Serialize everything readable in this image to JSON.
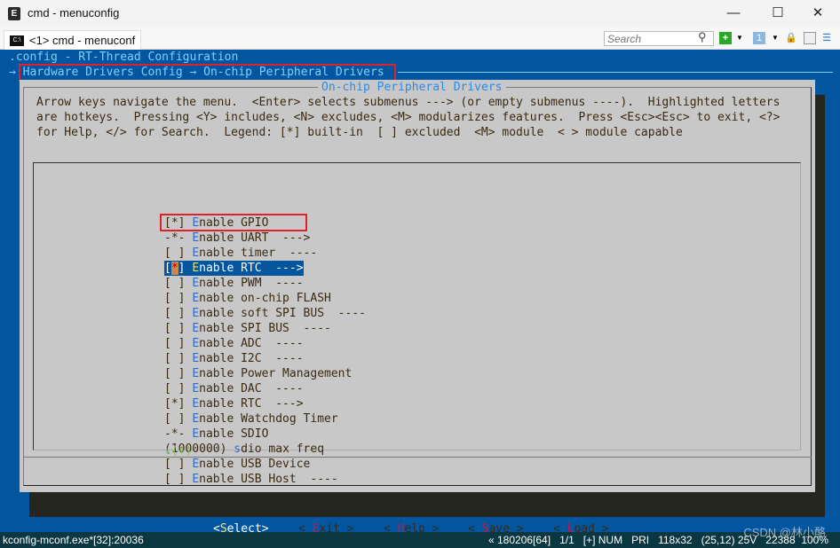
{
  "window": {
    "title": "cmd - menuconfig",
    "app_icon": "conemu-icon",
    "controls": [
      "minimize",
      "maximize",
      "close"
    ]
  },
  "tabbar": {
    "tab_label": "<1> cmd - menuconf",
    "search_placeholder": "Search",
    "icons": [
      "search-icon",
      "new-console-icon",
      "dropdown-icon",
      "pane-icon",
      "dropdown-icon",
      "lock-icon",
      "split-icon",
      "menu-icon"
    ]
  },
  "terminal": {
    "header": ".config - RT-Thread Configuration",
    "breadcrumb": "→ Hardware Drivers Config → On-chip Peripheral Drivers",
    "dialog_title": "On-chip Peripheral Drivers",
    "help_lines": [
      "Arrow keys navigate the menu.  <Enter> selects submenus ---> (or empty submenus ----).  Highlighted letters",
      "are hotkeys.  Pressing <Y> includes, <N> excludes, <M> modularizes features.  Press <Esc><Esc> to exit, <?>",
      "for Help, </> for Search.  Legend: [*] built-in  [ ] excluded  <M> module  < > module capable"
    ],
    "items": [
      {
        "prefix": "[*] ",
        "hotkey": "E",
        "rest": "nable GPIO"
      },
      {
        "prefix": "-*- ",
        "hotkey": "E",
        "rest": "nable UART  --->"
      },
      {
        "prefix": "[ ] ",
        "hotkey": "E",
        "rest": "nable timer  ----"
      },
      {
        "prefix": "[*] ",
        "hotkey": "E",
        "rest": "nable RTC  --->",
        "selected": true
      },
      {
        "prefix": "[ ] ",
        "hotkey": "E",
        "rest": "nable PWM  ----"
      },
      {
        "prefix": "[ ] ",
        "hotkey": "E",
        "rest": "nable on-chip FLASH"
      },
      {
        "prefix": "[ ] ",
        "hotkey": "E",
        "rest": "nable soft SPI BUS  ----"
      },
      {
        "prefix": "[ ] ",
        "hotkey": "E",
        "rest": "nable SPI BUS  ----"
      },
      {
        "prefix": "[ ] ",
        "hotkey": "E",
        "rest": "nable ADC  ----"
      },
      {
        "prefix": "[ ] ",
        "hotkey": "E",
        "rest": "nable I2C  ----"
      },
      {
        "prefix": "[ ] ",
        "hotkey": "E",
        "rest": "nable Power Management"
      },
      {
        "prefix": "[ ] ",
        "hotkey": "E",
        "rest": "nable DAC  ----"
      },
      {
        "prefix": "[*] ",
        "hotkey": "E",
        "rest": "nable RTC  --->"
      },
      {
        "prefix": "[ ] ",
        "hotkey": "E",
        "rest": "nable Watchdog Timer"
      },
      {
        "prefix": "-*- ",
        "hotkey": "E",
        "rest": "nable SDIO"
      },
      {
        "prefix": "(1000000) ",
        "hotkey": "s",
        "rest": "dio max freq"
      },
      {
        "prefix": "[ ] ",
        "hotkey": "E",
        "rest": "nable USB Device"
      },
      {
        "prefix": "[ ] ",
        "hotkey": "E",
        "rest": "nable USB Host  ----"
      }
    ],
    "more_indicator": "↓(+)",
    "buttons": [
      {
        "l": "<",
        "k": "S",
        "r": "elect>",
        "selected": true
      },
      {
        "l": "< ",
        "k": "E",
        "r": "xit >"
      },
      {
        "l": "< ",
        "k": "H",
        "r": "elp >"
      },
      {
        "l": "< ",
        "k": "S",
        "r": "ave >"
      },
      {
        "l": "< ",
        "k": "L",
        "r": "oad >"
      }
    ]
  },
  "statusbar": {
    "left": "kconfig-mconf.exe*[32]:20036",
    "right": "« 180206[64]   1/1   [+] NUM   PRI   118x32   (25,12) 25V   22388  100%"
  },
  "watermark": "CSDN @林小酪",
  "colors": {
    "terminal_bg": "#0256a0",
    "dialog_bg": "#c8c8c8",
    "highlight_box": "#e0202a",
    "hotkey": "#2a6ad8"
  }
}
